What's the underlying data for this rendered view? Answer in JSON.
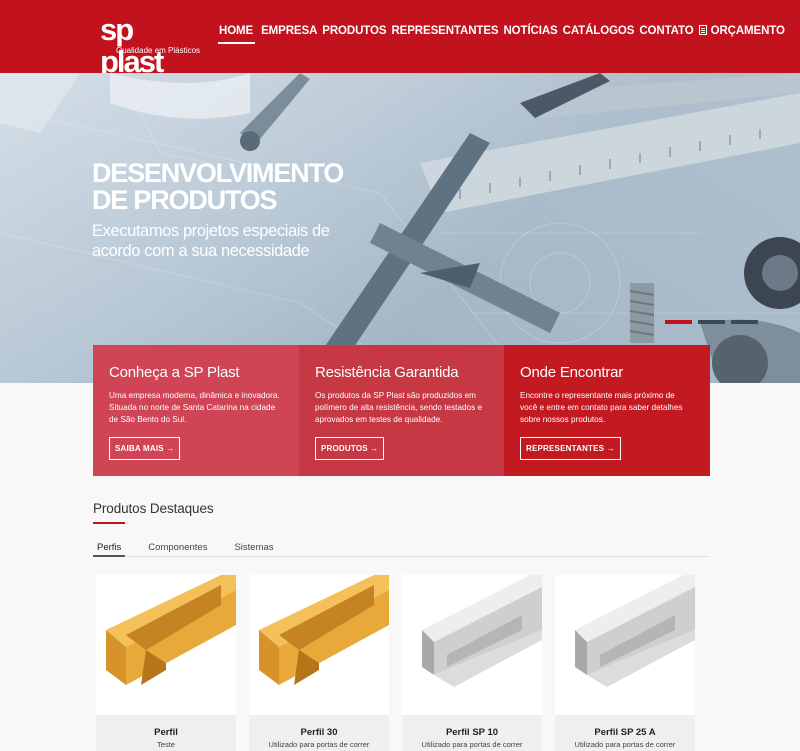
{
  "brand": {
    "logo": "sp plast",
    "tagline": "Qualidade em Plásticos"
  },
  "nav": {
    "items": [
      "HOME",
      "EMPRESA",
      "PRODUTOS",
      "REPRESENTANTES",
      "NOTÍCIAS",
      "CATÁLOGOS",
      "CONTATO",
      "ORÇAMENTO"
    ],
    "active": "HOME",
    "orcamento_icon": "document-icon"
  },
  "hero": {
    "title_line1": "DESENVOLVIMENTO",
    "title_line2": "DE PRODUTOS",
    "subtitle_line1": "Executamos projetos especiais de",
    "subtitle_line2": "acordo com a sua necessidade",
    "slides": 3,
    "active_slide": 1
  },
  "features": [
    {
      "title": "Conheça a SP Plast",
      "text": "Uma empresa moderna, dinâmica e inovadora. Situada no norte de Santa Catarina na cidade de São Bento do Sul.",
      "button": "SAIBA MAIS"
    },
    {
      "title": "Resistência Garantida",
      "text": "Os produtos da SP Plast são produzidos em polímero de alta resistência, sendo testados e aprovados em testes de qualidade.",
      "button": "PRODUTOS"
    },
    {
      "title": "Onde Encontrar",
      "text": "Encontre o representante mais próximo de você e entre em contato para saber detalhes sobre nossos produtos.",
      "button": "REPRESENTANTES"
    }
  ],
  "products": {
    "title": "Produtos Destaques",
    "tabs": [
      "Perfis",
      "Componentes",
      "Sistemas"
    ],
    "active_tab": "Perfis",
    "items": [
      {
        "name": "Perfil",
        "desc": "Teste",
        "color": "#e8a93a"
      },
      {
        "name": "Perfil 30",
        "desc": "Utilizado para portas de correr",
        "color": "#e8a93a"
      },
      {
        "name": "Perfil SP 10",
        "desc": "Utilizado para portas de correr",
        "color": "#c9c9c9"
      },
      {
        "name": "Perfil SP 25 A",
        "desc": "Utilizado para portas de correr",
        "color": "#c9c9c9"
      }
    ]
  },
  "colors": {
    "brand_red": "#c1121e"
  }
}
